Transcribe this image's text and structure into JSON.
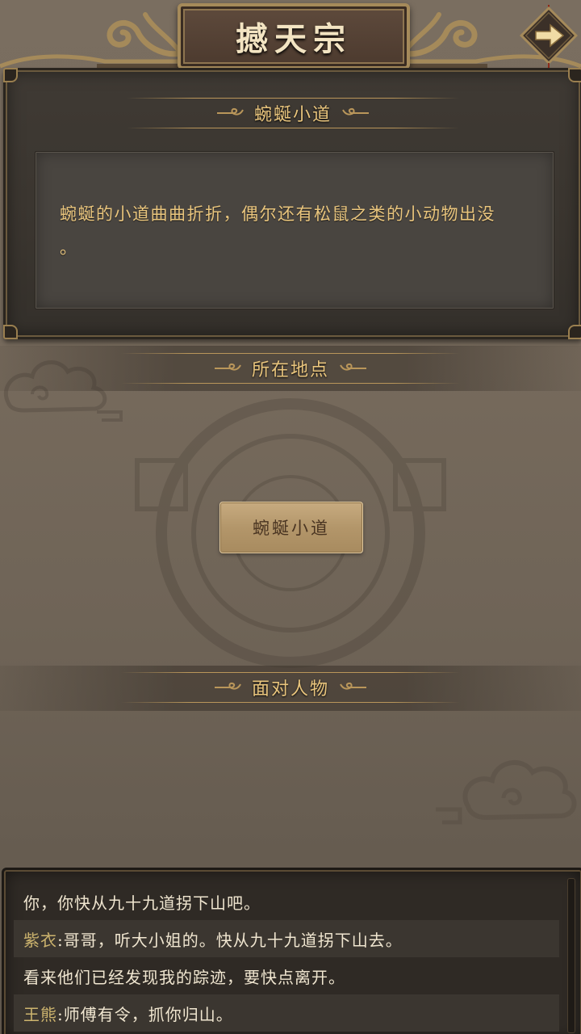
{
  "header": {
    "title": "撼天宗"
  },
  "scene": {
    "title": "蜿蜒小道",
    "description_line1": "蜿蜒的小道曲曲折折，偶尔还有松鼠之类的小动物出没",
    "description_line2": "。"
  },
  "location": {
    "section_title": "所在地点",
    "button_label": "蜿蜒小道"
  },
  "characters": {
    "section_title": "面对人物"
  },
  "log": {
    "lines": [
      {
        "speaker": "",
        "text": "你，你快从九十九道拐下山吧。"
      },
      {
        "speaker": "紫衣",
        "text": ":哥哥，听大小姐的。快从九十九道拐下山去。"
      },
      {
        "speaker": "",
        "text": "看来他们已经发现我的踪迹，要快点离开。"
      },
      {
        "speaker": "王熊",
        "text": ":师傅有令，抓你归山。"
      }
    ]
  },
  "colors": {
    "gold_text": "#e9c57d",
    "speaker_name": "#cdb46e",
    "panel_dark": "#3a352f",
    "button_tan": "#b3966a"
  },
  "icons": [
    "cloud-ornament-icon",
    "swirl-icon",
    "right-arrow-icon",
    "emblem-icon"
  ]
}
